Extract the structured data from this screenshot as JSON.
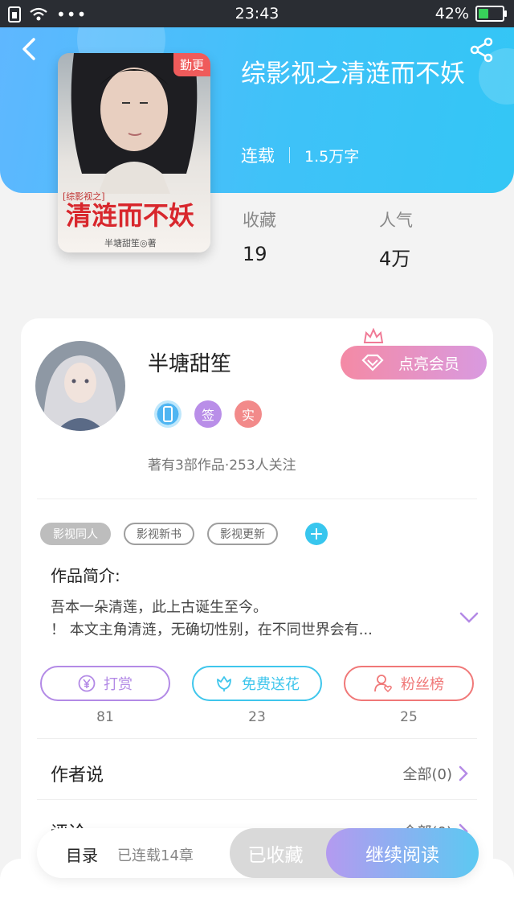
{
  "status_bar": {
    "time": "23:43",
    "battery": "42%",
    "battery_level": 0.42
  },
  "book": {
    "title": "综影视之清涟而不妖",
    "status": "连载",
    "word_count": "1.5万字",
    "cover_badge": "勤更",
    "cover_text": {
      "prefix": "[综影视之]",
      "title": "清涟而不妖",
      "author": "半塘甜笙◎著"
    }
  },
  "stats": [
    {
      "label": "收藏",
      "value": "19"
    },
    {
      "label": "人气",
      "value": "4万"
    }
  ],
  "author": {
    "name": "半塘甜笙",
    "badges": [
      "签",
      "实"
    ],
    "follow_text": "著有3部作品·253人关注",
    "vip_button": "点亮会员"
  },
  "tags": [
    "影视同人",
    "影视新书",
    "影视更新"
  ],
  "intro": {
    "title": "作品简介:",
    "lines": [
      "吾本一朵清莲，此上古诞生至今。",
      "！ 本文主角清涟，无确切性别，在不同世界会有..."
    ]
  },
  "actions": [
    {
      "label": "打赏",
      "count": "81",
      "color": "#b38ae6"
    },
    {
      "label": "免费送花",
      "count": "23",
      "color": "#3fc6ec"
    },
    {
      "label": "粉丝榜",
      "count": "25",
      "color": "#f07878"
    }
  ],
  "author_says": {
    "title": "作者说",
    "more": "全部(0)"
  },
  "comments": {
    "title": "评论",
    "more": "全部(0)"
  },
  "bottom": {
    "toc": "目录",
    "chapters": "已连载14章",
    "collected": "已收藏",
    "continue": "继续阅读"
  },
  "colors": {
    "hero": "#3fc2f8",
    "accent": "#38c6ee",
    "vip": "#f48aa5"
  }
}
